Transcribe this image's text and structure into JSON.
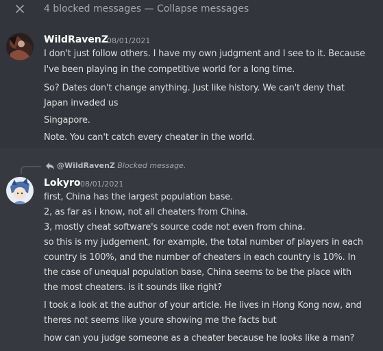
{
  "blocked_bar": {
    "text": "4 blocked messages — ",
    "collapse_label": "Collapse messages"
  },
  "blocked_messages": {
    "author": "WildRavenZ",
    "timestamp": "08/01/2021",
    "lines": [
      "I don't just follow others. I have my own judgment and I see to it. Because",
      "I've been playing in the competitive world for a long time.",
      "So? Dates don't change anything. Just like history. We can't deny that",
      "Japan invaded us",
      "Singapore.",
      "Note. You can't catch every cheater in the world."
    ]
  },
  "reply": {
    "author": "@WildRavenZ",
    "status": "Blocked message."
  },
  "message": {
    "author": "Lokyro",
    "timestamp": "08/01/2021",
    "lines": [
      "first, China has the largest population base.",
      "2, as far as i know, not all cheaters from China.",
      "3, mostly cheat software's source code not even from china.",
      "so this is my judgement, for example, the total number of players in each",
      "country is 100%, and the number of cheaters in each country is 10%. In",
      "the case of unequal population base, China seems to be the place with",
      "the most cheaters. is it sounds like right?",
      "I took a look at the author of your article. He lives in Hong Kong now, and",
      "theres not seems like youre showing me the facts but",
      "how can you judge someone as a cheater because he looks like a man?"
    ]
  },
  "icons": {
    "close": "close-icon",
    "reply": "reply-arrow-icon"
  },
  "colors": {
    "background": "#36393f",
    "blocked_background": "#32353b",
    "text": "#dcddde",
    "muted": "#a3a6aa",
    "username": "#ffffff"
  }
}
